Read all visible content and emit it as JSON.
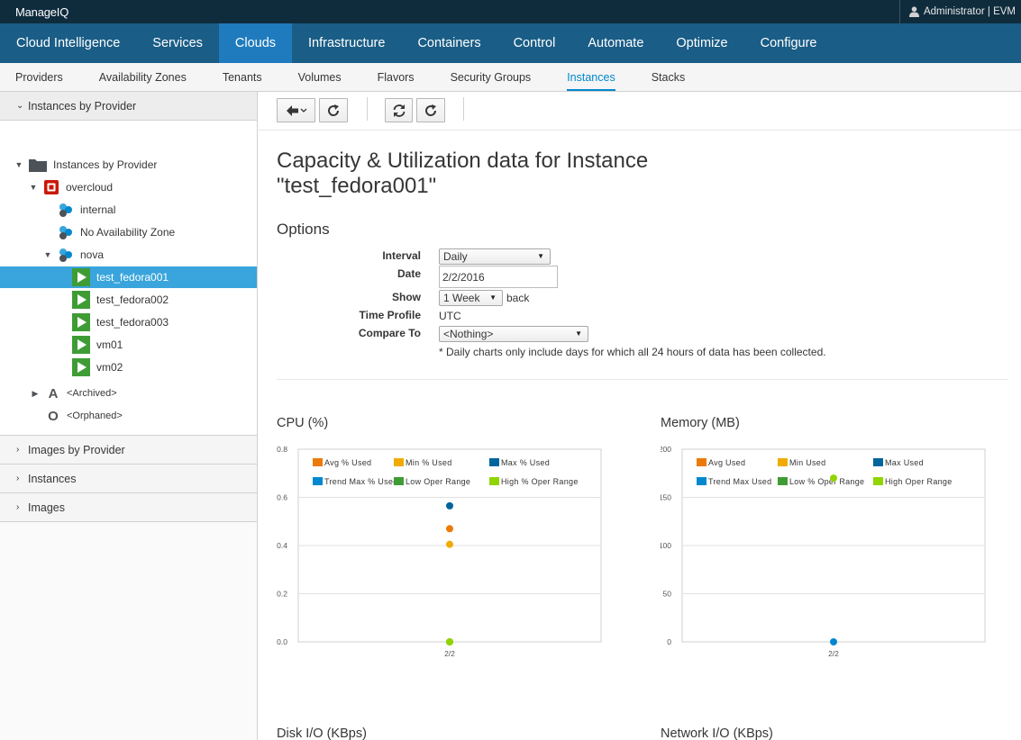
{
  "brand": "ManageIQ",
  "user": "Administrator | EVM",
  "main_nav": [
    "Cloud Intelligence",
    "Services",
    "Clouds",
    "Infrastructure",
    "Containers",
    "Control",
    "Automate",
    "Optimize",
    "Configure"
  ],
  "main_nav_active": "Clouds",
  "sub_nav": [
    "Providers",
    "Availability Zones",
    "Tenants",
    "Volumes",
    "Flavors",
    "Security Groups",
    "Instances",
    "Stacks"
  ],
  "sub_nav_active": "Instances",
  "sidebar": {
    "open_accordion": "Instances by Provider",
    "tree": {
      "root": "Instances by Provider",
      "provider": "overcloud",
      "zones": [
        "internal",
        "No Availability Zone",
        "nova"
      ],
      "instances": [
        "test_fedora001",
        "test_fedora002",
        "test_fedora003",
        "vm01",
        "vm02"
      ],
      "selected": "test_fedora001",
      "archived": "<Archived>",
      "orphaned": "<Orphaned>",
      "archived_letter": "A",
      "orphaned_letter": "O"
    },
    "accordions": [
      "Images by Provider",
      "Instances",
      "Images"
    ]
  },
  "page": {
    "title_line1": "Capacity & Utilization data for Instance",
    "title_line2": "\"test_fedora001\"",
    "options_heading": "Options",
    "labels": {
      "interval": "Interval",
      "date": "Date",
      "show": "Show",
      "time_profile": "Time Profile",
      "compare_to": "Compare To"
    },
    "interval_value": "Daily",
    "date_value": "2/2/2016",
    "show_value": "1 Week",
    "show_suffix": "back",
    "time_profile_value": "UTC",
    "compare_to_value": "<Nothing>",
    "note": "* Daily charts only include days for which all 24 hours of data has been collected."
  },
  "more_chart_titles": [
    "Disk I/O (KBps)",
    "Network I/O (KBps)"
  ],
  "chart_data": [
    {
      "type": "scatter",
      "title": "CPU (%)",
      "categories": [
        "2/2"
      ],
      "ylim": [
        0,
        0.8
      ],
      "yticks": [
        "0.0",
        "0.2",
        "0.4",
        "0.6",
        "0.8"
      ],
      "legend_placement": "top",
      "grid": true,
      "series": [
        {
          "name": "Avg % Used",
          "color": "#ec7a08",
          "values": [
            0.47
          ]
        },
        {
          "name": "Min % Used",
          "color": "#f0ab00",
          "values": [
            0.405
          ]
        },
        {
          "name": "Max % Used",
          "color": "#00659c",
          "values": [
            0.565
          ]
        },
        {
          "name": "Trend Max % Used",
          "color": "#0088ce",
          "values": [
            null
          ]
        },
        {
          "name": "Low Oper Range",
          "color": "#3f9c35",
          "values": [
            0
          ]
        },
        {
          "name": "High % Oper Range",
          "color": "#92d400",
          "values": [
            0
          ]
        }
      ]
    },
    {
      "type": "scatter",
      "title": "Memory (MB)",
      "categories": [
        "2/2"
      ],
      "ylim": [
        0,
        200
      ],
      "yticks": [
        "0",
        "50",
        "100",
        "150",
        "200"
      ],
      "legend_placement": "top",
      "grid": true,
      "series": [
        {
          "name": "Avg Used",
          "color": "#ec7a08",
          "values": [
            null
          ]
        },
        {
          "name": "Min Used",
          "color": "#f0ab00",
          "values": [
            null
          ]
        },
        {
          "name": "Max Used",
          "color": "#00659c",
          "values": [
            null
          ]
        },
        {
          "name": "Trend Max Used",
          "color": "#0088ce",
          "values": [
            0
          ]
        },
        {
          "name": "Low % Oper Range",
          "color": "#3f9c35",
          "values": [
            null
          ]
        },
        {
          "name": "High Oper Range",
          "color": "#92d400",
          "values": [
            170
          ]
        }
      ]
    }
  ]
}
